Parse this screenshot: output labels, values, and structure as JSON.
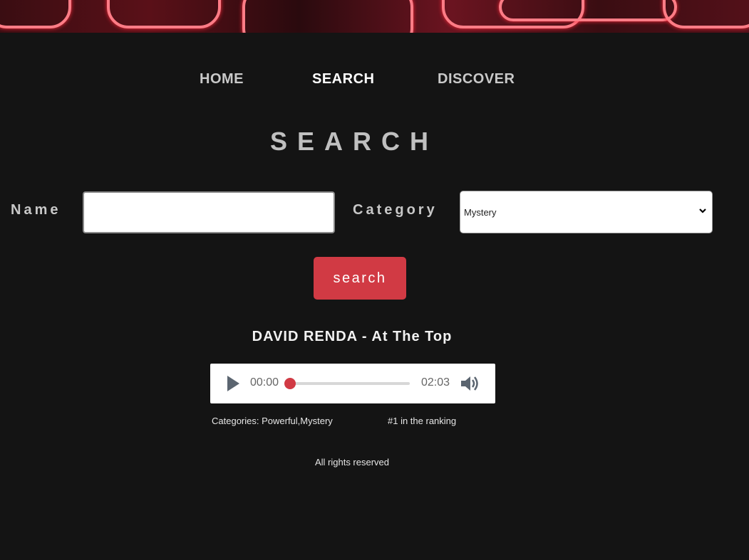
{
  "nav": {
    "items": [
      {
        "label": "HOME",
        "active": false
      },
      {
        "label": "SEARCH",
        "active": true
      },
      {
        "label": "DISCOVER",
        "active": false
      }
    ]
  },
  "page": {
    "title": "SEARCH"
  },
  "form": {
    "name_label": "Name",
    "name_value": "",
    "category_label": "Category",
    "category_value": "Mystery",
    "search_button": "search"
  },
  "result": {
    "title": "DAVID RENDA - At The Top",
    "player": {
      "current_time": "00:00",
      "duration": "02:03",
      "progress": 0
    },
    "categories": "Categories: Powerful,Mystery",
    "ranking": "#1 in the ranking"
  },
  "footer": {
    "text": "All rights reserved"
  },
  "colors": {
    "background": "#141414",
    "accent": "#d13a44"
  }
}
